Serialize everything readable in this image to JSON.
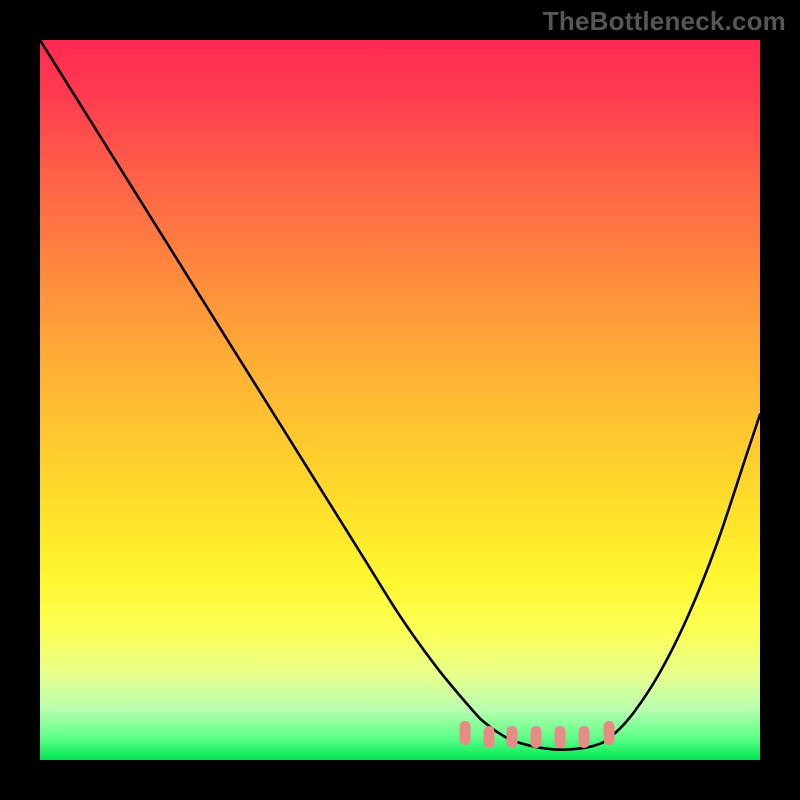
{
  "attribution": "TheBottleneck.com",
  "colors": {
    "page_bg": "#000000",
    "gradient_top": "#ff2a52",
    "gradient_bottom": "#00e654",
    "curve": "#000000",
    "marker": "#e88b87",
    "attribution_text": "#565656"
  },
  "chart_data": {
    "type": "line",
    "title": "",
    "xlabel": "",
    "ylabel": "",
    "xlim": [
      0,
      100
    ],
    "ylim": [
      0,
      100
    ],
    "grid": false,
    "legend": false,
    "series": [
      {
        "name": "bottleneck-curve",
        "x": [
          0,
          5,
          10,
          15,
          20,
          25,
          30,
          35,
          40,
          45,
          50,
          55,
          60,
          62,
          65,
          68,
          71,
          74,
          77,
          79,
          82,
          86,
          90,
          94,
          98,
          100
        ],
        "y": [
          100,
          92,
          84,
          76,
          68,
          60,
          52,
          44,
          36,
          28,
          20,
          13,
          7,
          5,
          3,
          2,
          1.5,
          1.5,
          2,
          3,
          6,
          12,
          20,
          30,
          42,
          48
        ]
      }
    ],
    "markers": {
      "name": "optimal-range",
      "y": 3.2,
      "x": [
        59,
        62.3,
        65.6,
        68.9,
        72.2,
        75.5,
        79
      ],
      "end_y_offset": 0.6
    },
    "background_gradient": [
      {
        "stop": 0.0,
        "color": "#ff2a52"
      },
      {
        "stop": 0.08,
        "color": "#ff3c4f"
      },
      {
        "stop": 0.18,
        "color": "#ff5e48"
      },
      {
        "stop": 0.3,
        "color": "#ff823f"
      },
      {
        "stop": 0.42,
        "color": "#ffa637"
      },
      {
        "stop": 0.54,
        "color": "#ffc530"
      },
      {
        "stop": 0.66,
        "color": "#ffe12a"
      },
      {
        "stop": 0.75,
        "color": "#fff730"
      },
      {
        "stop": 0.82,
        "color": "#fbff55"
      },
      {
        "stop": 0.88,
        "color": "#e8ff8a"
      },
      {
        "stop": 0.93,
        "color": "#b8ffb0"
      },
      {
        "stop": 0.97,
        "color": "#5bff87"
      },
      {
        "stop": 1.0,
        "color": "#00e654"
      }
    ]
  }
}
